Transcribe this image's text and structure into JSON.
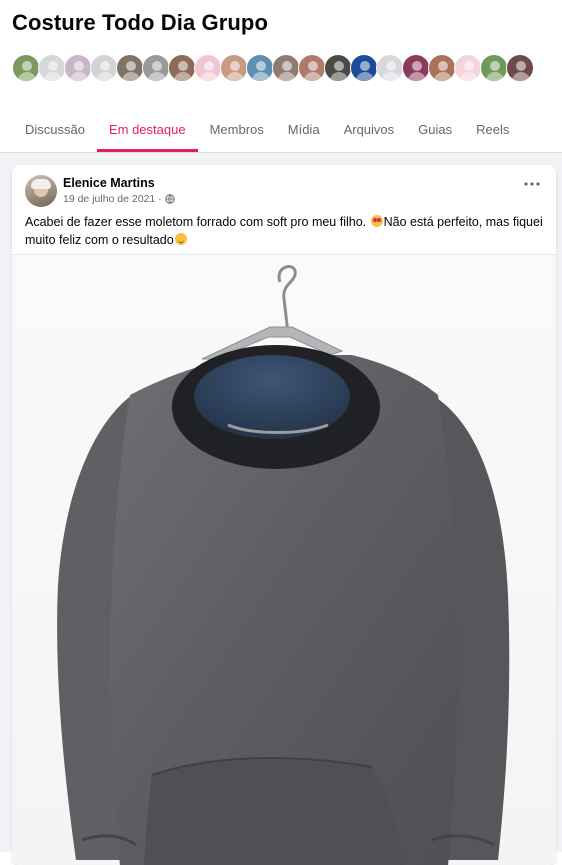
{
  "group": {
    "title": "Costure Todo Dia Grupo",
    "member_avatars": [
      {
        "color": "#7a9b5d"
      },
      {
        "color": "#d5d7da"
      },
      {
        "color": "#c7b7c9"
      },
      {
        "color": "#d1d3d6"
      },
      {
        "color": "#7f7466"
      },
      {
        "color": "#9a9a9a"
      },
      {
        "color": "#8e6a58"
      },
      {
        "color": "#f1c6d2"
      },
      {
        "color": "#c99a82"
      },
      {
        "color": "#5d8fb1"
      },
      {
        "color": "#8f7c6f"
      },
      {
        "color": "#b07a6a"
      },
      {
        "color": "#4c4a46"
      },
      {
        "color": "#1e4a9a"
      },
      {
        "color": "#d7d9dc"
      },
      {
        "color": "#8d3b5c"
      },
      {
        "color": "#a8735a"
      },
      {
        "color": "#f3d4dc"
      },
      {
        "color": "#6e9a5a"
      },
      {
        "color": "#6f4a4a"
      }
    ]
  },
  "tabs": [
    {
      "label": "Discussão",
      "active": false
    },
    {
      "label": "Em destaque",
      "active": true
    },
    {
      "label": "Membros",
      "active": false
    },
    {
      "label": "Mídia",
      "active": false
    },
    {
      "label": "Arquivos",
      "active": false
    },
    {
      "label": "Guias",
      "active": false
    },
    {
      "label": "Reels",
      "active": false
    }
  ],
  "post": {
    "author": "Elenice Martins",
    "date": "19 de julho de 2021 ·",
    "text_part1": "Acabei de fazer esse moletom forrado com soft pro meu filho.",
    "text_part2": "Não está perfeito, mas fiquei muito feliz com o resultado",
    "privacy_icon": "globe-icon",
    "photo_alt": "Moletom cinza com gola preta pendurado em cabide"
  },
  "colors": {
    "accent": "#e41e57",
    "feed_background": "#f0f2f5",
    "muted_text": "#65676b"
  }
}
